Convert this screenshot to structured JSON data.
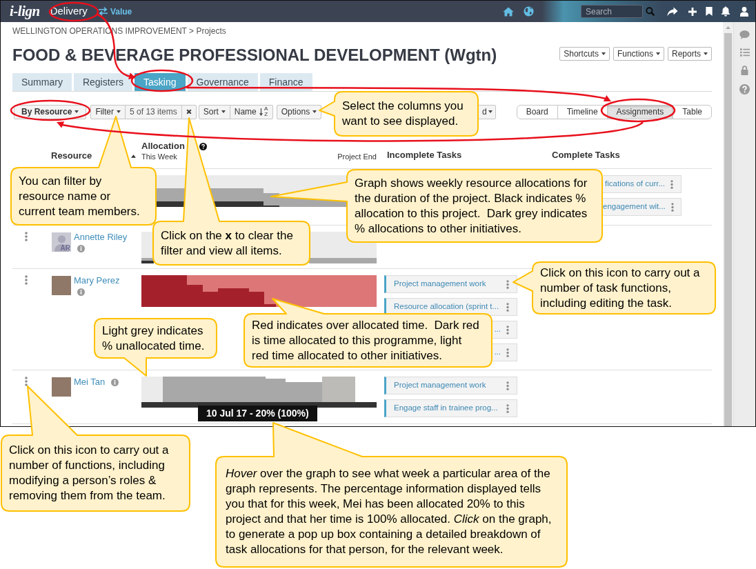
{
  "top_bar": {
    "logo": "i-lign",
    "module": "Delivery",
    "switch": "Value",
    "search": {
      "placeholder": "Search"
    }
  },
  "breadcrumb": "WELLINGTON OPERATIONS IMPROVEMENT > Projects",
  "title": "FOOD & BEVERAGE PROFESSIONAL DEVELOPMENT (Wgtn)",
  "header_buttons": [
    "Shortcuts",
    "Functions",
    "Reports"
  ],
  "tabs": [
    {
      "label": "Summary",
      "selected": false
    },
    {
      "label": "Registers",
      "selected": false
    },
    {
      "label": "Tasking",
      "selected": true
    },
    {
      "label": "Governance",
      "selected": false
    },
    {
      "label": "Finance",
      "selected": false
    }
  ],
  "toolbar": {
    "group_by": "By Resource",
    "filter": {
      "label": "Filter",
      "count": "5 of 13 items"
    },
    "sort": {
      "label": "Sort",
      "field": "Name",
      "order": "A Z"
    },
    "options": "Options",
    "cut_off_button": "d",
    "views": [
      {
        "label": "Board",
        "selected": false
      },
      {
        "label": "Timeline",
        "selected": false
      },
      {
        "label": "Assignments",
        "selected": true
      },
      {
        "label": "Table",
        "selected": false
      }
    ]
  },
  "columns": {
    "resource": "Resource",
    "allocation": "Allocation",
    "this_week": "This Week",
    "project_end": "Project End",
    "incomplete": "Incomplete Tasks",
    "complete": "Complete Tasks"
  },
  "resources": [
    {
      "over_allocated": false,
      "complete_tasks": [
        {
          "label": "fications of curr..."
        },
        {
          "label": "engagement wit..."
        }
      ]
    },
    {
      "name": "Annette Riley",
      "avatar": {
        "kind": "initials",
        "initials": "AR"
      },
      "over_allocated": false
    },
    {
      "name": "Mary Perez",
      "avatar": {
        "kind": "photo"
      },
      "over_allocated": true,
      "incomplete_tasks": [
        {
          "label": "Project management work"
        },
        {
          "label": "Resource allocation (sprint t..."
        },
        {
          "label": "..."
        },
        {
          "label": "..."
        }
      ]
    },
    {
      "name": "Mei Tan",
      "avatar": {
        "kind": "photo"
      },
      "over_allocated": false,
      "incomplete_tasks": [
        {
          "label": "Project management work"
        },
        {
          "label": "Engage staff in trainee prog..."
        }
      ],
      "tooltip": "10 Jul 17 - 20% (100%)"
    }
  ],
  "callouts": [
    {
      "text": "Select the columns you want to see displayed."
    },
    {
      "text": "You can filter by resource name or current team members."
    },
    {
      "text": "Graph shows weekly resource allocations for the duration of the project. Black indicates % allocation to this project.  Dark grey indicates % allocations to other initiatives."
    },
    {
      "text": "Click on the **x** to clear the filter and view all items."
    },
    {
      "text": "Click on this icon to carry out a number of task functions, including editing the task."
    },
    {
      "text": "Light grey indicates % unallocated time."
    },
    {
      "text": "Red indicates over allocated time.  Dark red is time allocated to this programme, light red time allocated to other initiatives."
    },
    {
      "text": "Click on this icon to carry out a number of functions, including modifying a person’s roles & removing them from the team."
    },
    {
      "text": "*Hover* over the graph to see what week a particular area of the graph represents. The percentage information displayed tells you that for this week, Mei has been allocated 20% to this project and that her time is 100% allocated. *Click* on the graph, to generate a pop up box containing a detailed breakdown of task allocations for that person, for the relevant week."
    }
  ]
}
